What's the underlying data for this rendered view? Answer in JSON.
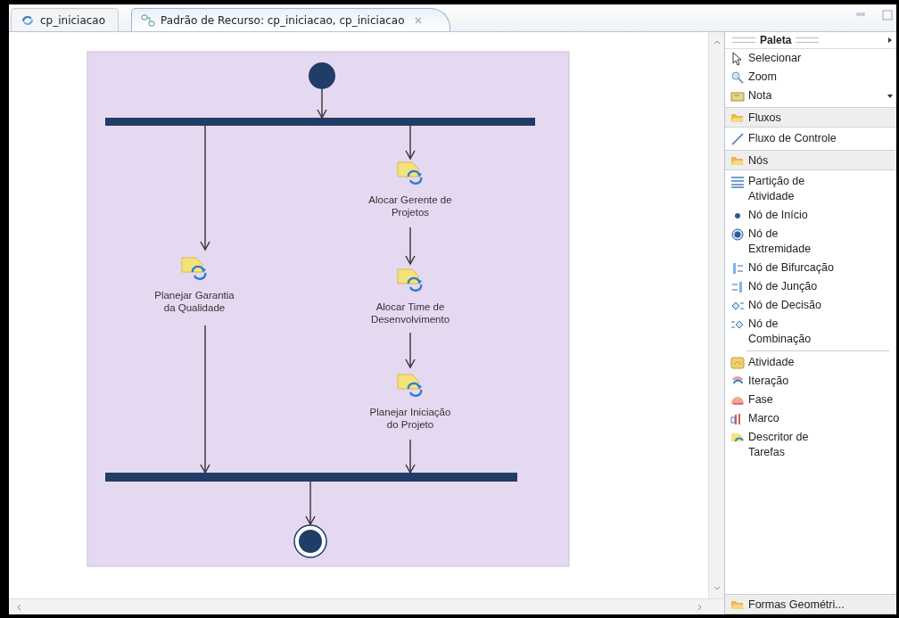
{
  "tabs": [
    {
      "label": "cp_iniciacao",
      "selected": false
    },
    {
      "label": "Padrão de Recurso: cp_iniciacao, cp_iniciacao",
      "selected": true
    }
  ],
  "diagram": {
    "tasks": [
      {
        "label": "Planejar Garantia da Qualidade"
      },
      {
        "label": "Alocar Gerente de Projetos"
      },
      {
        "label": "Alocar Time de Desenvolvimento"
      },
      {
        "label": "Planejar Iniciação do Projeto"
      }
    ]
  },
  "palette": {
    "title": "Paleta",
    "sections": [
      {
        "items": [
          {
            "kind": "pointer",
            "label": "Selecionar"
          },
          {
            "kind": "zoom",
            "label": "Zoom"
          },
          {
            "kind": "note",
            "label": "Nota"
          }
        ]
      },
      {
        "drawer": "Fluxos",
        "items": [
          {
            "kind": "flow",
            "label": "Fluxo de Controle"
          }
        ]
      },
      {
        "drawer": "Nós",
        "items": [
          {
            "kind": "partition",
            "label": "Partição de Atividade"
          },
          {
            "kind": "initial",
            "label": "Nó de Início"
          },
          {
            "kind": "final",
            "label": "Nó de Extremidade"
          },
          {
            "kind": "fork",
            "label": "Nó de Bifurcação"
          },
          {
            "kind": "join",
            "label": "Nó de Junção"
          },
          {
            "kind": "decision",
            "label": "Nó de Decisão"
          },
          {
            "kind": "merge",
            "label": "Nó de Combinação"
          },
          {
            "kind": "separator"
          },
          {
            "kind": "activity",
            "label": "Atividade"
          },
          {
            "kind": "iteration",
            "label": "Iteração"
          },
          {
            "kind": "phase",
            "label": "Fase"
          },
          {
            "kind": "milestone",
            "label": "Marco"
          },
          {
            "kind": "task",
            "label": "Descritor de Tarefas"
          }
        ]
      }
    ],
    "bottom_drawer": "Formas Geométri..."
  }
}
